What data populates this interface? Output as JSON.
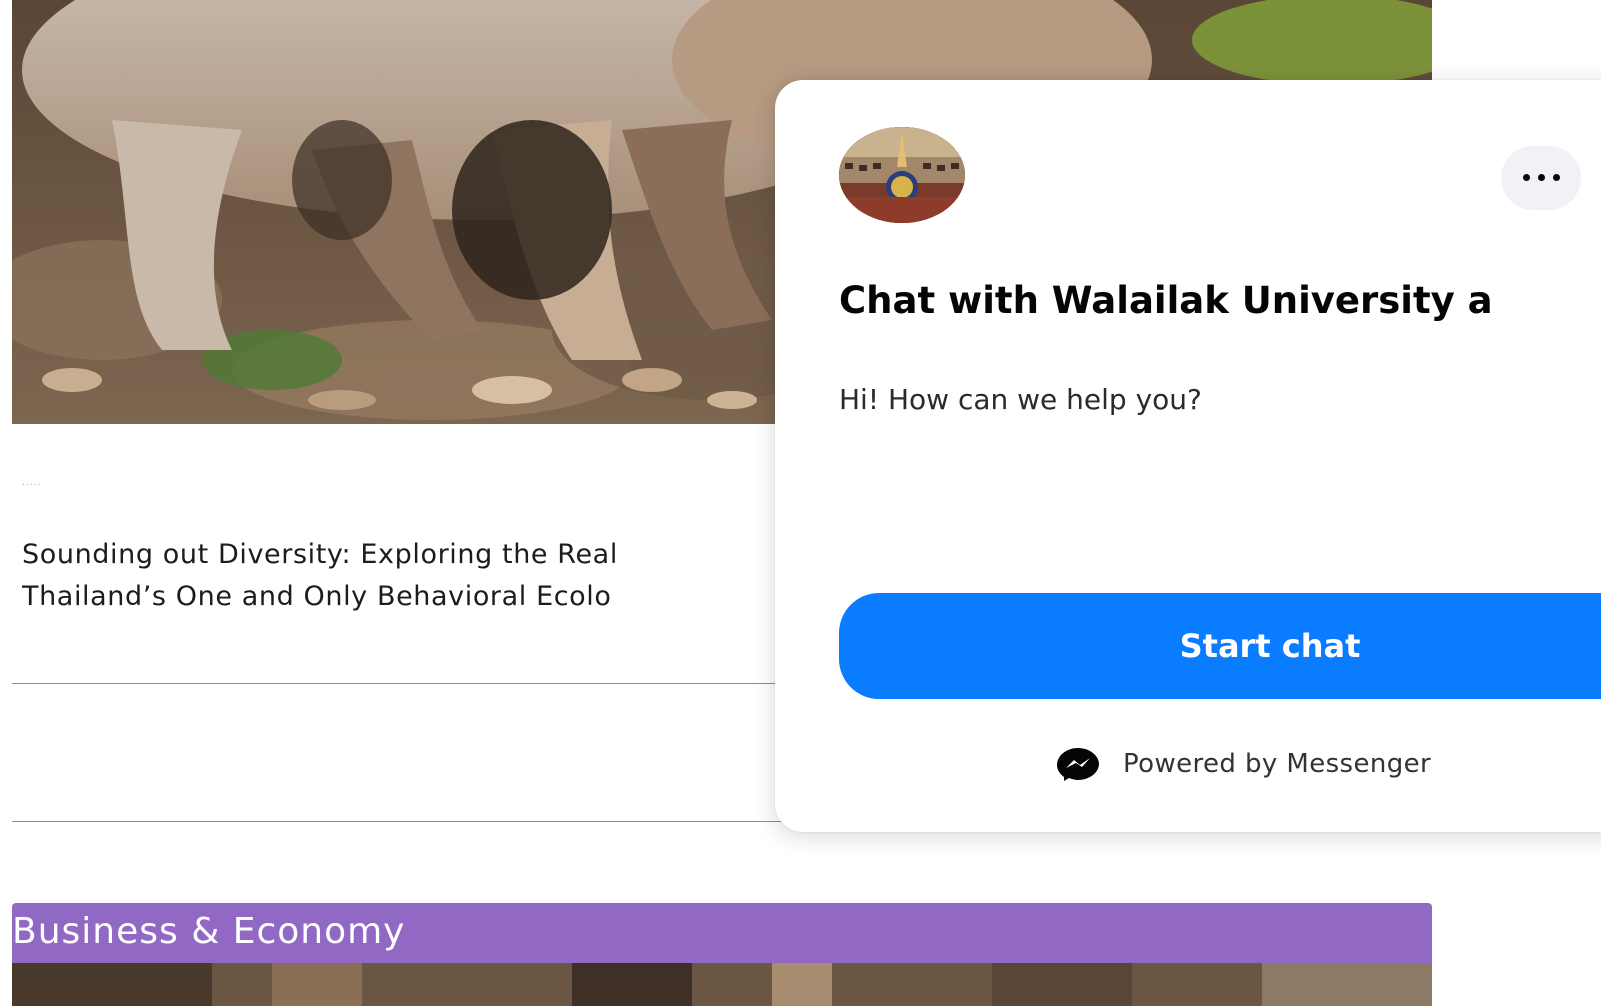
{
  "article": {
    "meta": ".....",
    "title_line_1": "Sounding out Diversity: Exploring the Real",
    "title_line_2": "Thailand’s One and Only Behavioral Ecolo"
  },
  "category": {
    "title": "Business & Economy"
  },
  "chat_widget": {
    "heading": "Chat with Walailak University a",
    "greeting": "Hi! How can we help you?",
    "start_chat_label": "Start chat",
    "powered_by": "Powered by Messenger"
  },
  "colors": {
    "messenger_blue": "#0a7cff",
    "category_purple": "#9168c4",
    "divider_purple": "#9b79d1"
  },
  "icons": {
    "more": "more-horizontal-icon",
    "messenger": "messenger-icon"
  }
}
